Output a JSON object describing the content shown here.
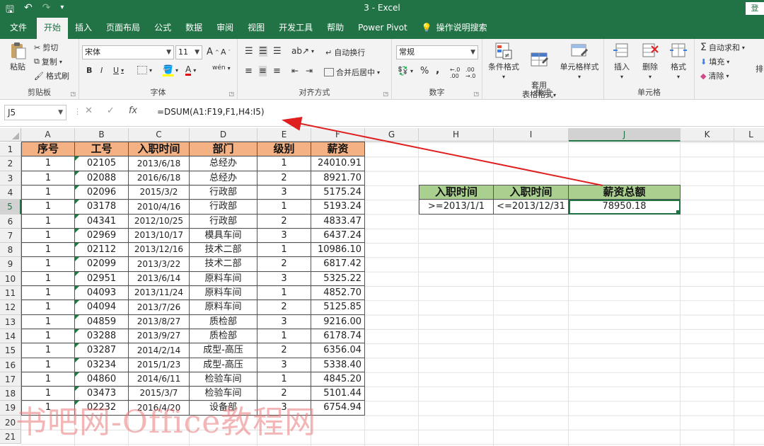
{
  "window": {
    "title": "3  -  Excel",
    "login": "登"
  },
  "tabs": [
    "文件",
    "开始",
    "插入",
    "页面布局",
    "公式",
    "数据",
    "审阅",
    "视图",
    "开发工具",
    "帮助",
    "Power Pivot",
    "操作说明搜索"
  ],
  "ribbon": {
    "clipboard": {
      "paste": "粘贴",
      "cut": "剪切",
      "copy": "复制",
      "format_painter": "格式刷",
      "label": "剪贴板"
    },
    "font": {
      "name": "宋体",
      "size": "11",
      "grow": "A",
      "shrink": "A",
      "bold": "B",
      "italic": "I",
      "underline": "U",
      "font_color_a": "A",
      "wen": "wén",
      "label": "字体"
    },
    "alignment": {
      "wrap": "自动换行",
      "merge": "合并后居中",
      "label": "对齐方式"
    },
    "number": {
      "format": "常规",
      "percent": "%",
      "comma": ",",
      "label": "数字"
    },
    "styles": {
      "conditional": "条件格式",
      "table_format": "套用\n表格格式",
      "cell_styles": "单元格样式",
      "label": "样式"
    },
    "cells": {
      "insert": "插入",
      "delete": "删除",
      "format": "格式",
      "label": "单元格"
    },
    "editing": {
      "autosum": "自动求和",
      "fill": "填充",
      "clear": "清除",
      "sort": "排"
    }
  },
  "formula_bar": {
    "name_box": "J5",
    "formula": "=DSUM(A1:F19,F1,H4:I5)"
  },
  "columns": [
    "A",
    "B",
    "C",
    "D",
    "E",
    "F",
    "G",
    "H",
    "I",
    "J",
    "K",
    "L"
  ],
  "rows": [
    "1",
    "2",
    "3",
    "4",
    "5",
    "6",
    "7",
    "8",
    "9",
    "10",
    "11",
    "12",
    "13",
    "14",
    "15",
    "16",
    "17",
    "18",
    "19",
    "20",
    "21"
  ],
  "table": {
    "headers": [
      "序号",
      "工号",
      "入职时间",
      "部门",
      "级别",
      "薪资"
    ],
    "rows": [
      [
        "1",
        "02105",
        "2013/6/18",
        "总经办",
        "1",
        "24010.91"
      ],
      [
        "1",
        "02088",
        "2016/6/18",
        "总经办",
        "2",
        "8921.70"
      ],
      [
        "1",
        "02096",
        "2015/3/2",
        "行政部",
        "3",
        "5175.24"
      ],
      [
        "1",
        "03178",
        "2010/4/16",
        "行政部",
        "1",
        "5193.24"
      ],
      [
        "1",
        "04341",
        "2012/10/25",
        "行政部",
        "2",
        "4833.47"
      ],
      [
        "1",
        "02969",
        "2013/10/17",
        "模具车间",
        "3",
        "6437.24"
      ],
      [
        "1",
        "02112",
        "2013/12/16",
        "技术二部",
        "1",
        "10986.10"
      ],
      [
        "1",
        "02099",
        "2013/3/22",
        "技术二部",
        "2",
        "6817.42"
      ],
      [
        "1",
        "02951",
        "2013/6/14",
        "原料车间",
        "3",
        "5325.22"
      ],
      [
        "1",
        "04093",
        "2013/11/24",
        "原料车间",
        "1",
        "4852.70"
      ],
      [
        "1",
        "04094",
        "2013/7/26",
        "原料车间",
        "2",
        "5125.85"
      ],
      [
        "1",
        "04859",
        "2013/8/27",
        "质检部",
        "3",
        "9216.00"
      ],
      [
        "1",
        "03288",
        "2013/9/27",
        "质检部",
        "1",
        "6178.74"
      ],
      [
        "1",
        "03287",
        "2014/2/14",
        "成型-高压",
        "2",
        "6356.04"
      ],
      [
        "1",
        "03234",
        "2015/1/23",
        "成型-高压",
        "3",
        "5338.40"
      ],
      [
        "1",
        "04860",
        "2014/6/11",
        "检验车间",
        "1",
        "4845.20"
      ],
      [
        "1",
        "03473",
        "2015/3/7",
        "检验车间",
        "2",
        "5101.44"
      ],
      [
        "1",
        "02232",
        "2016/4/20",
        "设备部",
        "3",
        "6754.94"
      ]
    ]
  },
  "criteria": {
    "headers": [
      "入职时间",
      "入职时间",
      "薪资总额"
    ],
    "values": [
      ">=2013/1/1",
      "<=2013/12/31",
      "78950.18"
    ]
  },
  "watermark": "书吧网-Office教程网",
  "colors": {
    "excel_green": "#217346",
    "header_orange": "#f4b183",
    "header_green": "#a9d08e",
    "arrow_red": "#e02020"
  }
}
